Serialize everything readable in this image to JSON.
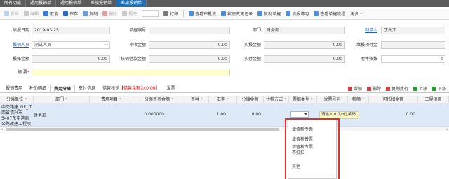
{
  "tabs": [
    {
      "label": "所有功能",
      "active": false
    },
    {
      "label": "通用报销单",
      "active": false
    },
    {
      "label": "通用报销单",
      "active": false
    },
    {
      "label": "差旅报销单",
      "active": false
    },
    {
      "label": "差旅报销单",
      "active": true
    }
  ],
  "toolbar": {
    "add": "新增",
    "edit": "编辑",
    "cancel": "取消",
    "save": "保存",
    "copy": "复制",
    "delete": "删除",
    "submit": "提交",
    "print_combo": "",
    "print": "打印",
    "view_approval": "查看审批流",
    "status_change": "状态变更记录",
    "copy_doc": "复制单据",
    "fill_help": "填报说明",
    "view_flow": "查看单据流程",
    "more": "更多"
  },
  "form": {
    "fill_date_label": "填报日期",
    "fill_date": "2019-03-25",
    "doc_no_label": "单据编号",
    "doc_no": "",
    "dept_label": "部门",
    "dept": "财务部",
    "person_label": "制单人",
    "person": "丁光文",
    "reporter_label": "报销人员",
    "reporter": "测试人员",
    "supplement_label": "补收金额",
    "supplement": "0.00",
    "actual_label": "实报金额",
    "actual": "0.00",
    "advance_label": "填报预付金",
    "advance": "",
    "total_label": "报账金额",
    "total": "0.00",
    "offset_label": "核销借款金额",
    "offset": "0.00",
    "paid_label": "实付金额",
    "paid": "0.00",
    "attach_label": "附件张数",
    "attach": "",
    "remark_label": "摘 要",
    "remark": ""
  },
  "subtabs": {
    "items": [
      "报销费用",
      "补助明细",
      "费用分摊",
      "支付信息",
      "借款核销",
      "发票"
    ],
    "offset_suffix": "【借款余额为:0.00】",
    "actions": [
      "增加",
      "删除",
      "复制此行",
      "上移",
      "下移"
    ]
  },
  "grid": {
    "headers": [
      "分摊单位",
      "部门",
      "费用项目",
      "分摊币币金额",
      "币种",
      "汇率",
      "分摊金额",
      "计税方式",
      "票据类型",
      "发票号码",
      "税额",
      "可抵扣金额",
      "工程项目"
    ],
    "row": {
      "unit": "中交路建_NF_江西省请兴市5407东屯港商公路改建工程项目",
      "dept": "财务部",
      "fee_item": "",
      "amount_orig": "0.000000",
      "currency": "",
      "rate": "1.00",
      "amount": "0.00",
      "tax_method": "",
      "invoice_type": "",
      "invoice_no_hint": "请输入10为3位编码",
      "tax": "",
      "deductible": "0.00",
      "project": ""
    }
  },
  "dropdown": {
    "options": [
      "增值税专票",
      "增值税普票",
      "增值税专票\n不抵扣",
      "其他"
    ]
  },
  "colors": {
    "active_tab": "#1f6fb4",
    "link": "#1f5fbf",
    "highlight_border": "#e03030",
    "row_bg": "#dde9f7"
  }
}
